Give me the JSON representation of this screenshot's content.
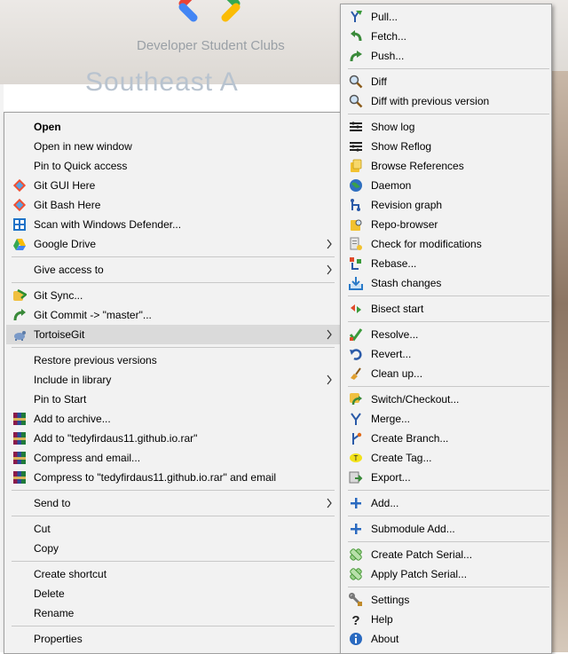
{
  "background": {
    "org_text": "Developer Student Clubs",
    "title_fragment": "Southeast A"
  },
  "main_menu": {
    "items": [
      {
        "label": "Open"
      },
      {
        "label": "Open in new window"
      },
      {
        "label": "Pin to Quick access"
      },
      {
        "label": "Git GUI Here"
      },
      {
        "label": "Git Bash Here"
      },
      {
        "label": "Scan with Windows Defender..."
      },
      {
        "label": "Google Drive"
      },
      {
        "label": "Give access to"
      },
      {
        "label": "Git Sync..."
      },
      {
        "label": "Git Commit -> \"master\"..."
      },
      {
        "label": "TortoiseGit"
      },
      {
        "label": "Restore previous versions"
      },
      {
        "label": "Include in library"
      },
      {
        "label": "Pin to Start"
      },
      {
        "label": "Add to archive..."
      },
      {
        "label": "Add to \"tedyfirdaus11.github.io.rar\""
      },
      {
        "label": "Compress and email..."
      },
      {
        "label": "Compress to \"tedyfirdaus11.github.io.rar\" and email"
      },
      {
        "label": "Send to"
      },
      {
        "label": "Cut"
      },
      {
        "label": "Copy"
      },
      {
        "label": "Create shortcut"
      },
      {
        "label": "Delete"
      },
      {
        "label": "Rename"
      },
      {
        "label": "Properties"
      }
    ]
  },
  "tortoisegit_menu": {
    "items": [
      {
        "label": "Pull..."
      },
      {
        "label": "Fetch..."
      },
      {
        "label": "Push..."
      },
      {
        "label": "Diff"
      },
      {
        "label": "Diff with previous version"
      },
      {
        "label": "Show log"
      },
      {
        "label": "Show Reflog"
      },
      {
        "label": "Browse References"
      },
      {
        "label": "Daemon"
      },
      {
        "label": "Revision graph"
      },
      {
        "label": "Repo-browser"
      },
      {
        "label": "Check for modifications"
      },
      {
        "label": "Rebase..."
      },
      {
        "label": "Stash changes"
      },
      {
        "label": "Bisect start"
      },
      {
        "label": "Resolve..."
      },
      {
        "label": "Revert..."
      },
      {
        "label": "Clean up..."
      },
      {
        "label": "Switch/Checkout..."
      },
      {
        "label": "Merge..."
      },
      {
        "label": "Create Branch..."
      },
      {
        "label": "Create Tag..."
      },
      {
        "label": "Export..."
      },
      {
        "label": "Add..."
      },
      {
        "label": "Submodule Add..."
      },
      {
        "label": "Create Patch Serial..."
      },
      {
        "label": "Apply Patch Serial..."
      },
      {
        "label": "Settings"
      },
      {
        "label": "Help"
      },
      {
        "label": "About"
      }
    ]
  },
  "colors": {
    "menu_bg": "#f2f2f2",
    "highlight": "#dadada",
    "separator": "#c8c8c8"
  }
}
